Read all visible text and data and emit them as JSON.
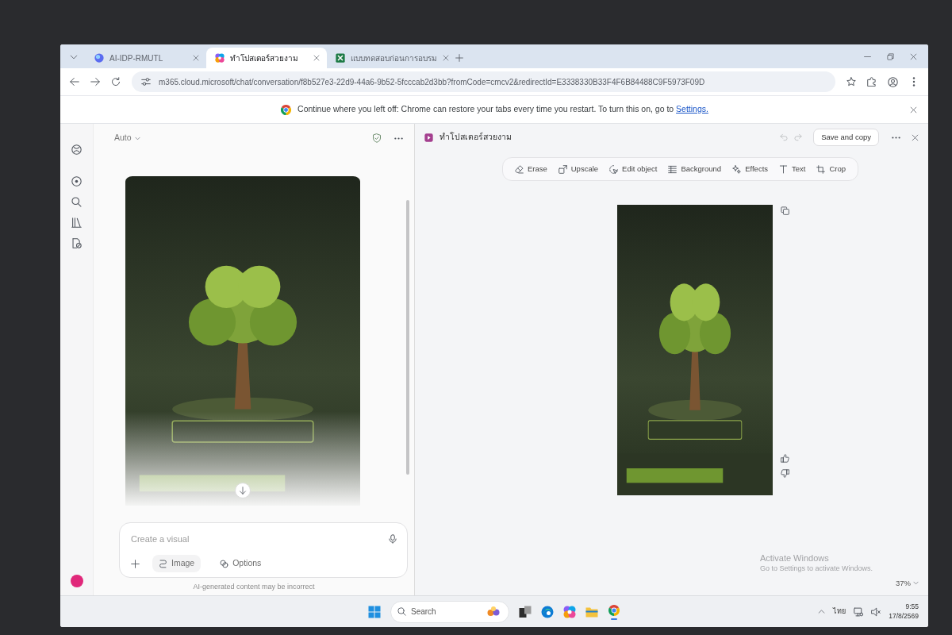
{
  "browser": {
    "tabs": [
      {
        "title": "AI-IDP-RMUTL",
        "selected": false
      },
      {
        "title": "ทำโปสเตอร์สวยงาม",
        "selected": true
      },
      {
        "title": "แบบทดสอบก่อนการอบรม",
        "selected": false
      }
    ],
    "url": "m365.cloud.microsoft/chat/conversation/f8b527e3-22d9-44a6-9b52-5fcccab2d3bb?fromCode=cmcv2&redirectId=E3338330B33F4F6B84488C9F5973F09D",
    "infobar": {
      "message": "Continue where you left off: Chrome can restore your tabs every time you restart. To turn this on, go to",
      "link": "Settings."
    }
  },
  "chat": {
    "mode": "Auto",
    "composer": {
      "placeholder": "Create a visual",
      "buttons": [
        "Image",
        "Options"
      ]
    },
    "disclaimer": "AI-generated content may be incorrect"
  },
  "editor": {
    "title": "ทำโปสเตอร์สวยงาม",
    "save_button": "Save and copy",
    "tools": [
      "Erase",
      "Upscale",
      "Edit object",
      "Background",
      "Effects",
      "Text",
      "Crop"
    ],
    "zoom": "37%"
  },
  "activation_notice": {
    "title": "Activate Windows",
    "message": "Go to Settings to activate Windows."
  },
  "taskbar": {
    "search_placeholder": "Search",
    "apps": [
      {
        "running": false
      },
      {
        "running": false
      },
      {
        "running": false
      },
      {
        "running": false
      },
      {
        "running": true
      }
    ],
    "tray": {
      "language": "ไทย",
      "time": "9:55",
      "date": "17/8/2569"
    }
  }
}
